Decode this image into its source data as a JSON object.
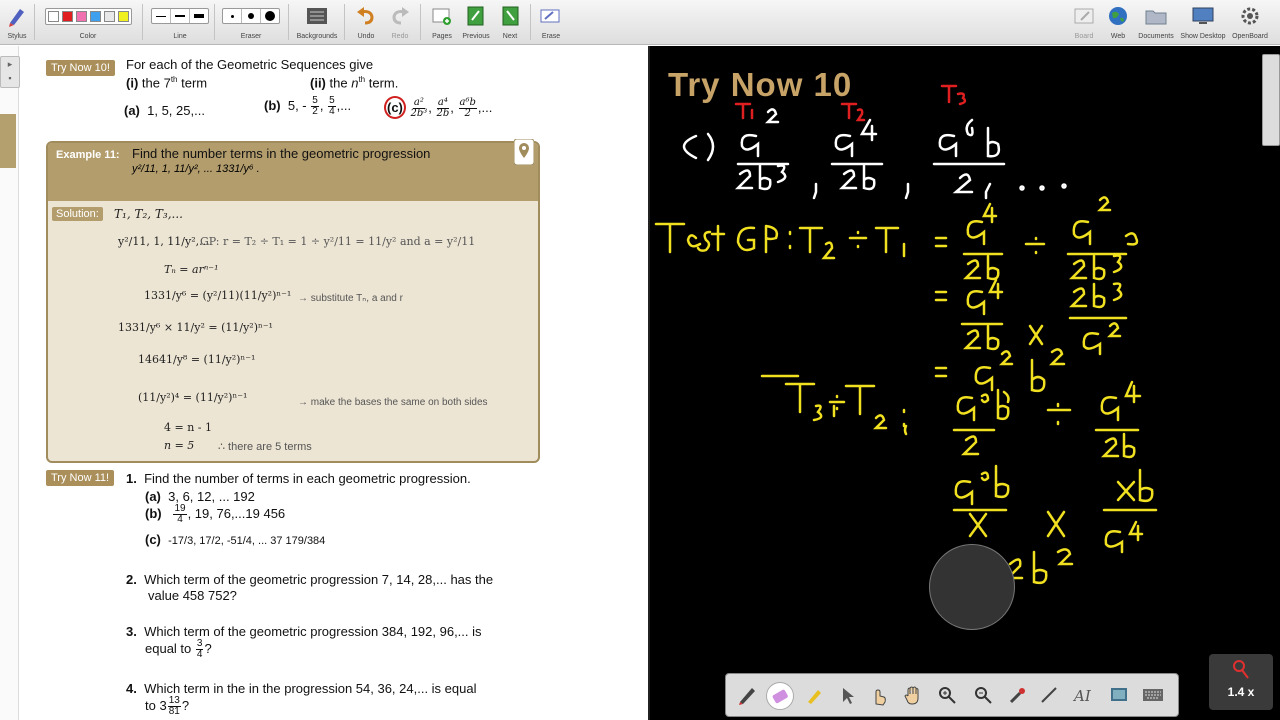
{
  "toolbar": {
    "stylus": "Stylus",
    "color": "Color",
    "line": "Line",
    "eraser": "Eraser",
    "backgrounds": "Backgrounds",
    "undo": "Undo",
    "redo": "Redo",
    "pages": "Pages",
    "previous": "Previous",
    "next": "Next",
    "erase": "Erase",
    "board": "Board",
    "web": "Web",
    "documents": "Documents",
    "show_desktop": "Show Desktop",
    "openboard": "OpenBoard",
    "colors": [
      "#ffffff",
      "#e02020",
      "#f070b0",
      "#40a0f0",
      "#e8e8e8",
      "#f0f020"
    ]
  },
  "left": {
    "try10_tag": "Try Now 10!",
    "try10_text": "For each of the Geometric Sequences give",
    "try10_i": "(i)",
    "try10_i_text": "the 7",
    "try10_i_sup": "th",
    "try10_i_end": "term",
    "try10_ii": "(ii)",
    "try10_ii_text": "the",
    "try10_ii_n": "n",
    "try10_ii_sup": "th",
    "try10_ii_end": "term.",
    "a_label": "(a)",
    "a_seq": "1, 5, 25,...",
    "b_label": "(b)",
    "b_seq": "5, -",
    "b_f1n": "5",
    "b_f1d": "2",
    "b_f2n": "5",
    "b_f2d": "4",
    "b_end": ",...",
    "c_label": "(c)",
    "c_f1n": "a²",
    "c_f1d": "2b³",
    "c_f2n": "a⁴",
    "c_f2d": "2b",
    "c_f3n": "a⁶b",
    "c_f3d": "2",
    "c_end": ",...",
    "ex11_title": "Example 11:",
    "ex11_text": "Find the number terms in the geometric progression",
    "ex11_seq_pre": "y²/11, 1, 11/y², ... 1331/y⁶ .",
    "solution_tag": "Solution:",
    "sol_terms": "T₁, T₂, T₃,...",
    "sol_line1": "y²/11, 1, 11/y²,...",
    "sol_gp": "GP: r = T₂ ÷ T₁ = 1 ÷ y²/11 = 11/y²   and a = y²/11",
    "sol_tn": "Tₙ = arⁿ⁻¹",
    "sol_l3": "1331/y⁶ = (y²/11)(11/y²)ⁿ⁻¹",
    "sol_l3_note": "→ substitute Tₙ, a and r",
    "sol_l4": "1331/y⁶ × 11/y² = (11/y²)ⁿ⁻¹",
    "sol_l5": "14641/y⁸ = (11/y²)ⁿ⁻¹",
    "sol_l6": "(11/y²)⁴ = (11/y²)ⁿ⁻¹",
    "sol_l6_note": "→ make the bases the same on both sides",
    "sol_l7": "4 = n - 1",
    "sol_l8": "n = 5",
    "sol_l8_note": "∴ there are 5 terms",
    "try11_tag": "Try Now 11!",
    "q1_num": "1.",
    "q1_text": "Find the number of terms in each geometric progression.",
    "q1a_label": "(a)",
    "q1a_text": "3, 6, 12, ... 192",
    "q1b_label": "(b)",
    "q1b_fn": "19",
    "q1b_fd": "4",
    "q1b_text": ", 19, 76,...19 456",
    "q1c_label": "(c)",
    "q1c_text": "-17/3, 17/2, -51/4, ... 37 179/384",
    "q2_num": "2.",
    "q2_text": "Which term of the geometric progression 7, 14, 28,... has the",
    "q2_text2": "value 458 752?",
    "q3_num": "3.",
    "q3_text": "Which term of the geometric progression   384, 192, 96,... is",
    "q3_text2": "equal to",
    "q3_fn": "3",
    "q3_fd": "4",
    "q3_end": "?",
    "q4_num": "4.",
    "q4_text": "Which term in the in the progression 54, 36, 24,... is equal",
    "q4_text2": "to 3",
    "q4_fn": "13",
    "q4_fd": "81",
    "q4_end": "?"
  },
  "board": {
    "title": "Try Now 10",
    "t1": "T₁",
    "t2": "T₂",
    "t3": "T₃",
    "c_label": "c)",
    "test_gp": "Test GP: T₂ ÷ T₁",
    "t3_t2": "T₃ ÷ T₂:",
    "ink_yellow": "#f0e020",
    "ink_white": "#ffffff",
    "ink_red": "#e02020",
    "zoom": "1.4 x"
  }
}
